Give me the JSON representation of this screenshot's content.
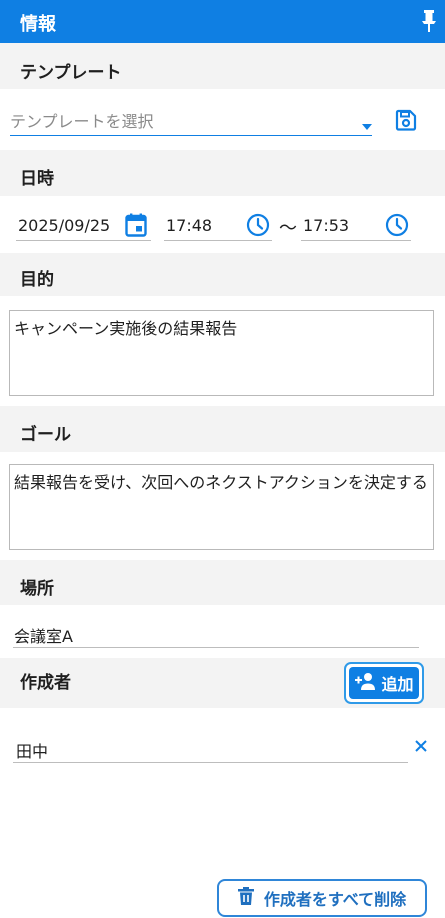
{
  "header": {
    "title": "情報",
    "pin_icon": "pin-icon"
  },
  "template": {
    "label": "テンプレート",
    "placeholder": "テンプレートを選択",
    "dropdown_icon": "caret-down-icon",
    "save_icon": "save-icon"
  },
  "datetime": {
    "label": "日時",
    "date": "2025/09/25",
    "start_time": "17:48",
    "separator": "〜",
    "end_time": "17:53"
  },
  "purpose": {
    "label": "目的",
    "value": "キャンペーン実施後の結果報告"
  },
  "goal": {
    "label": "ゴール",
    "value": "結果報告を受け、次回へのネクストアクションを決定する"
  },
  "location": {
    "label": "場所",
    "value": "会議室A"
  },
  "authors": {
    "label": "作成者",
    "add_label": "追加",
    "items": [
      "田中"
    ],
    "remove_icon": "close-icon",
    "delete_all_label": "作成者をすべて削除"
  },
  "colors": {
    "accent": "#0f7fe3",
    "section_bg": "#f3f3f3"
  }
}
